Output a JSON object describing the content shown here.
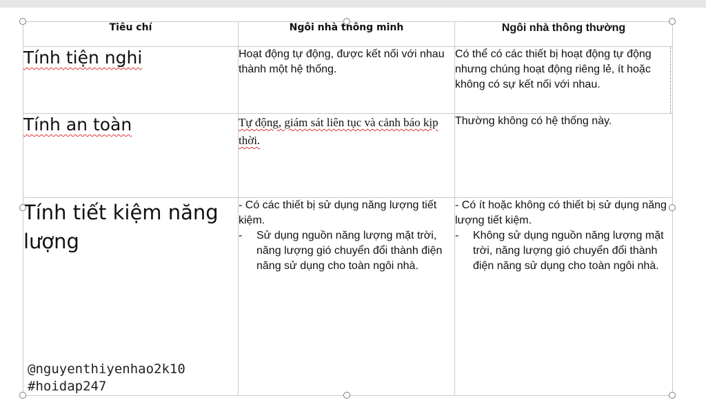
{
  "table": {
    "headers": [
      "Tiêu chí",
      "Ngôi nhà thông minh",
      "Ngôi nhà thông thường"
    ],
    "rows": [
      {
        "criterion": "Tính tiện nghi",
        "smart": "Hoạt động tự động, được kết nối với nhau thành một hệ thống.",
        "normal": "Có thể có các thiết bị hoạt động tự động nhưng chúng hoạt động riêng lẻ, ít hoặc không có sự kết nối với nhau."
      },
      {
        "criterion": "Tính an toàn",
        "smart": "Tự động, giám sát liên tục và cảnh báo kịp thời.",
        "normal": "Thường không có hệ thống này."
      },
      {
        "criterion": "Tính tiết kiệm năng lượng",
        "smart_line1": "- Có các thiết bị sử dụng năng lượng tiết kiệm.",
        "smart_dash": "-",
        "smart_line2": "Sử dụng nguồn năng lượng mặt trời, năng lượng gió chuyển đổi thành điện năng sử dụng cho toàn ngôi nhà.",
        "normal_line1": "- Có ít hoặc không có thiết bị sử dụng năng lượng tiết kiệm.",
        "normal_dash": "-",
        "normal_line2": "Không sử dụng nguồn năng lượng mặt trời, năng lượng gió chuyển đổi thành điện năng sử dụng cho toàn ngôi nhà."
      }
    ]
  },
  "watermark": {
    "line1": "@nguyenthiyenhao2k10",
    "line2": "#hoidap247"
  }
}
